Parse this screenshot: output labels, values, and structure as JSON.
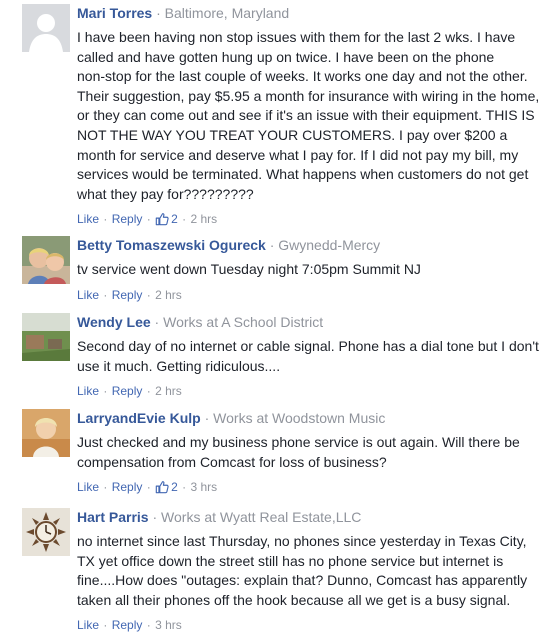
{
  "comments": [
    {
      "name": "Mari Torres",
      "meta": "Baltimore, Maryland",
      "text": "I have been having non stop issues with them for the last 2 wks. I have\ncalled and have gotten hung up on twice. I have been on the phone\nnon-stop for the last couple of weeks. It works one day and not the other.\nTheir suggestion, pay $5.95 a month for insurance with wiring in the home,\nor they can come out and see if it's an issue with their equipment. THIS IS\nNOT THE WAY YOU TREAT YOUR CUSTOMERS. I pay over $200 a\nmonth for service and deserve what I pay for. If I did not pay my bill, my\nservices would be terminated. What happens when customers do not get\nwhat they pay for?????????",
      "like_label": "Like",
      "reply_label": "Reply",
      "likes": "2",
      "time": "2 hrs",
      "avatar_icon": "default-profile-silhouette"
    },
    {
      "name": "Betty Tomaszewski Ogureck",
      "meta": "Gwynedd-Mercy",
      "text": "tv service went down Tuesday night 7:05pm Summit NJ",
      "like_label": "Like",
      "reply_label": "Reply",
      "time": "2 hrs",
      "avatar_icon": "profile-photo-children"
    },
    {
      "name": "Wendy Lee",
      "meta": "Works at A School District",
      "text": "Second day of no internet or cable signal. Phone has a dial tone but I don't\nuse it much. Getting ridiculous....",
      "like_label": "Like",
      "reply_label": "Reply",
      "time": "2 hrs",
      "avatar_icon": "profile-photo-landscape"
    },
    {
      "name": "LarryandEvie Kulp",
      "meta": "Works at Woodstown Music",
      "text": "Just checked and my business phone service is out again. Will there be\ncompensation from Comcast for loss of business?",
      "like_label": "Like",
      "reply_label": "Reply",
      "likes": "2",
      "time": "3 hrs",
      "avatar_icon": "profile-photo-child"
    },
    {
      "name": "Hart Parris",
      "meta": "Works at Wyatt Real Estate,LLC",
      "text": "no internet since last Thursday, no phones since yesterday in Texas City,\nTX yet office down the street still has no phone service but internet is\nfine....How does \"outages: explain that? Dunno, Comcast has apparently\ntaken all their phones off the hook because all we get is a busy signal.",
      "like_label": "Like",
      "reply_label": "Reply",
      "time": "3 hrs",
      "avatar_icon": "profile-photo-clock"
    }
  ],
  "colors": {
    "name": "#365899",
    "link": "#4267b2",
    "meta": "#90949c",
    "text": "#1d2129"
  }
}
